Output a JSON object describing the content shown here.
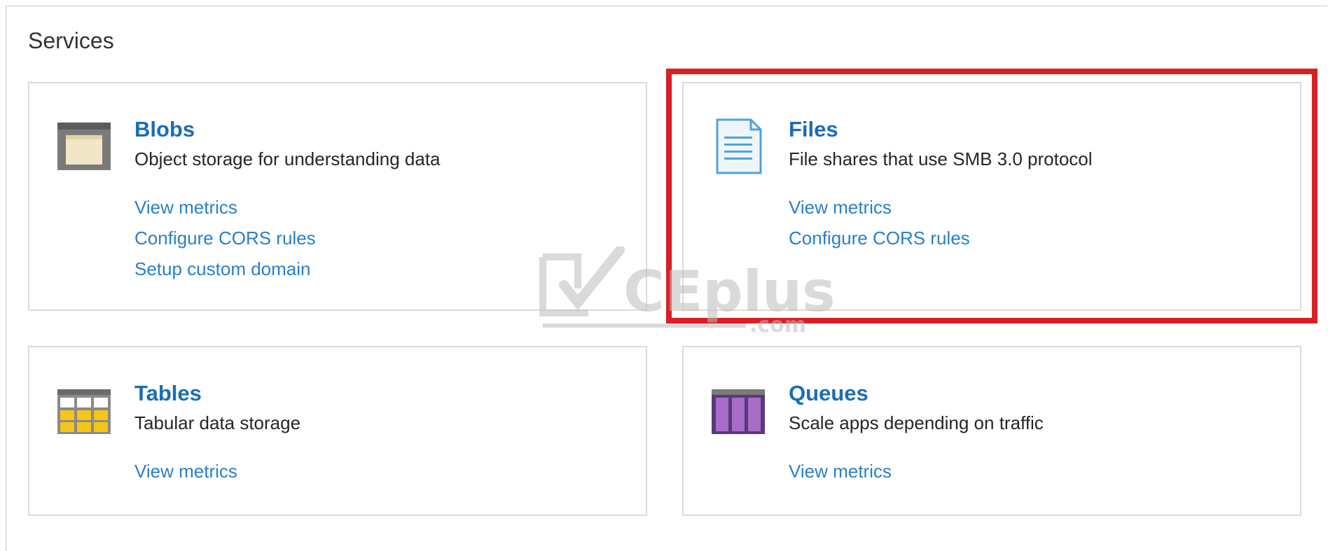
{
  "page": {
    "heading": "Services"
  },
  "services": [
    {
      "id": "blobs",
      "title": "Blobs",
      "description": "Object storage for understanding data",
      "icon": "folder-storage-icon",
      "links": [
        "View metrics",
        "Configure CORS rules",
        "Setup custom domain"
      ]
    },
    {
      "id": "files",
      "title": "Files",
      "description": "File shares that use SMB 3.0 protocol",
      "icon": "document-icon",
      "links": [
        "View metrics",
        "Configure CORS rules"
      ]
    },
    {
      "id": "tables",
      "title": "Tables",
      "description": "Tabular data storage",
      "icon": "table-grid-icon",
      "links": [
        "View metrics"
      ]
    },
    {
      "id": "queues",
      "title": "Queues",
      "description": "Scale apps depending on traffic",
      "icon": "queue-columns-icon",
      "links": [
        "View metrics"
      ]
    }
  ],
  "highlight": {
    "target": "files",
    "color": "#d81f26"
  },
  "watermark": {
    "text": "CEplus",
    "subtext": ".com"
  },
  "colors": {
    "title_link": "#1a6db5",
    "link": "#2a7fc9",
    "tile_border": "#dcdcdc"
  }
}
